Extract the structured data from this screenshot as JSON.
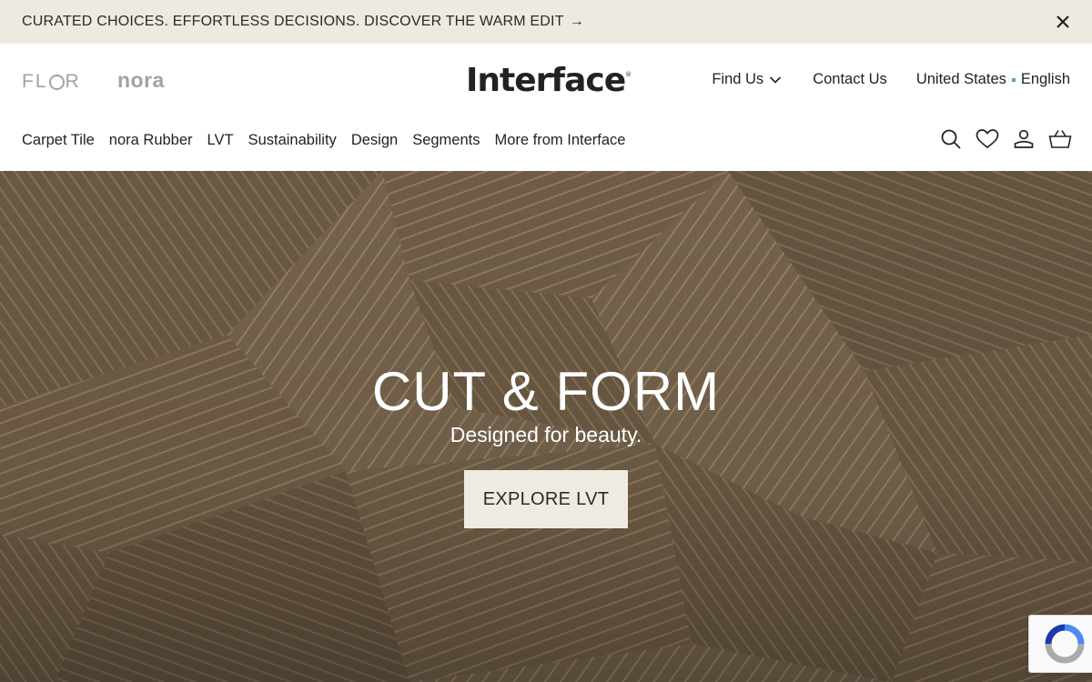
{
  "announcement": {
    "text": "CURATED CHOICES. EFFORTLESS DECISIONS. DISCOVER THE WARM EDIT",
    "arrow": "→",
    "close_icon": "close-icon"
  },
  "brands": {
    "flor_prefix": "FL",
    "flor_suffix": "R",
    "nora": "nora"
  },
  "logo": {
    "text": "Interface",
    "mark": "®"
  },
  "utility_nav": {
    "find_us": "Find Us",
    "contact_us": "Contact Us",
    "region": "United States",
    "language": "English"
  },
  "main_nav": {
    "items": [
      "Carpet Tile",
      "nora Rubber",
      "LVT",
      "Sustainability",
      "Design",
      "Segments",
      "More from Interface"
    ]
  },
  "header_icons": [
    "search-icon",
    "heart-icon",
    "account-icon",
    "basket-icon"
  ],
  "hero": {
    "title": "CUT & FORM",
    "subtitle": "Designed for beauty.",
    "cta": "EXPLORE LVT"
  },
  "colors": {
    "announcement_bg": "#edeae1",
    "hero_base": "#6e5c45",
    "cta_bg": "#efebe2",
    "accent_dot": "#4fb0a0",
    "brand_gray": "#a2a2a2"
  }
}
